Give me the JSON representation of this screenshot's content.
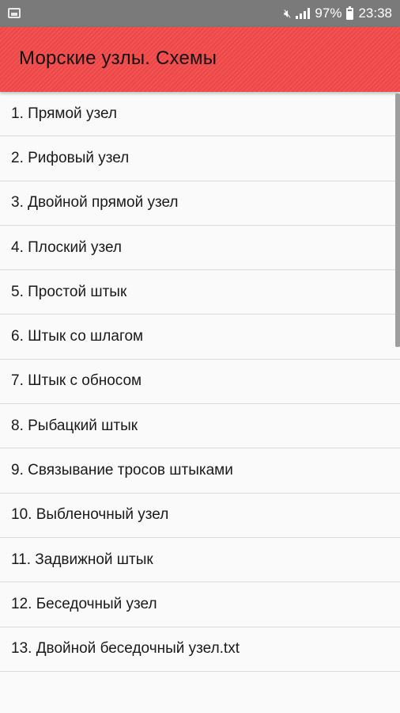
{
  "status_bar": {
    "battery_percent": "97%",
    "time": "23:38",
    "icons": [
      "image-notification-icon",
      "mute-icon",
      "signal-icon",
      "battery-icon"
    ]
  },
  "app_bar": {
    "title": "Морские узлы. Схемы",
    "color": "#f44a4a"
  },
  "list": {
    "items": [
      {
        "label": "1. Прямой узел"
      },
      {
        "label": "2. Рифовый узел"
      },
      {
        "label": "3. Двойной прямой узел"
      },
      {
        "label": "4. Плоский узел"
      },
      {
        "label": "5. Простой штык"
      },
      {
        "label": "6. Штык со шлагом"
      },
      {
        "label": "7. Штык с обносом"
      },
      {
        "label": "8. Рыбацкий штык"
      },
      {
        "label": "9. Связывание тросов штыками"
      },
      {
        "label": "10. Выбленочный узел"
      },
      {
        "label": "11. Задвижной штык"
      },
      {
        "label": "12. Беседочный узел"
      },
      {
        "label": "13. Двойной беседочный узел.txt"
      }
    ]
  }
}
